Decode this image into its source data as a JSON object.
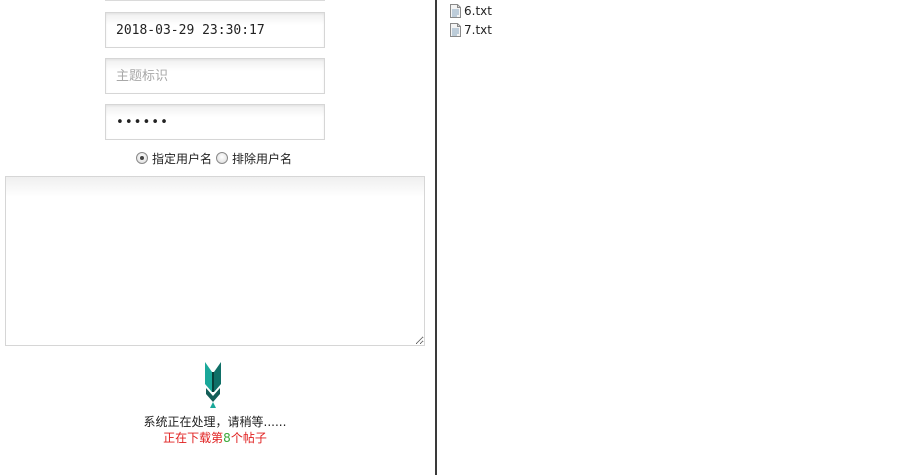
{
  "form": {
    "datetime_value": "2018-03-29 23:30:17",
    "topic_placeholder": "主题标识",
    "password_value": "123456",
    "radio_include_label": "指定用户名",
    "radio_exclude_label": "排除用户名",
    "selected_radio": "include",
    "textarea_value": ""
  },
  "status": {
    "processing_text": "系统正在处理，请稍等......",
    "download_prefix": "正在下载第",
    "download_count": "8",
    "download_suffix": "个帖子"
  },
  "files": [
    {
      "name": "6.txt",
      "icon": "text-file-icon"
    },
    {
      "name": "7.txt",
      "icon": "text-file-icon"
    }
  ],
  "colors": {
    "status_red": "#e02020",
    "status_green": "#3aa83a",
    "divider": "#3a3a3a",
    "spinner_teal": "#1aa89a"
  }
}
